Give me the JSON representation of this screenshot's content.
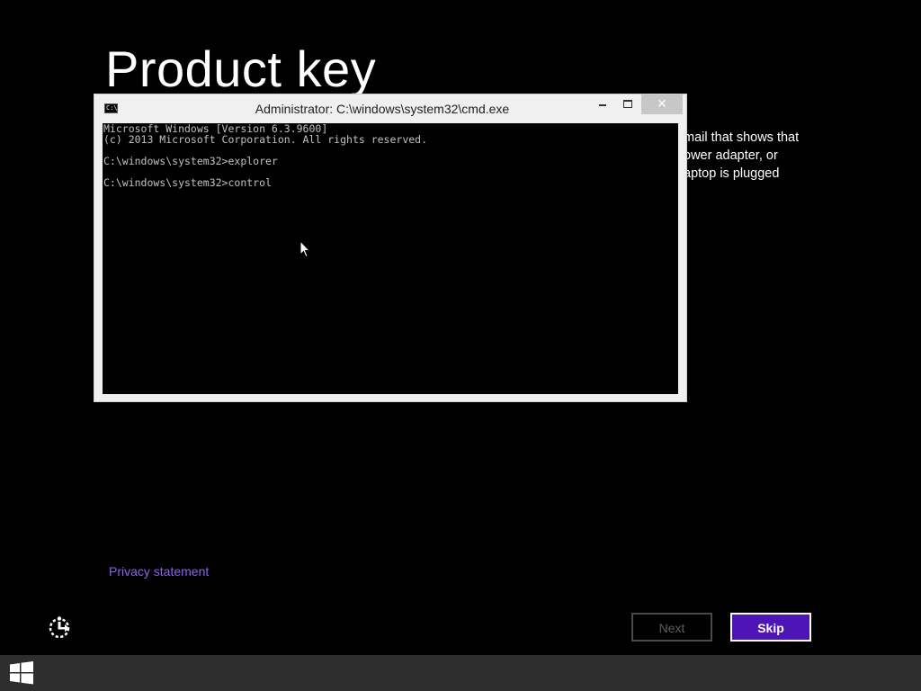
{
  "page": {
    "title": "Product key",
    "description_lines": [
      "mail that shows that",
      "ower adapter, or",
      "aptop is plugged"
    ]
  },
  "cmd": {
    "title": "Administrator: C:\\windows\\system32\\cmd.exe",
    "icon_text": "C:\\",
    "close_glyph": "✕",
    "lines": [
      "Microsoft Windows [Version 6.3.9600]",
      "(c) 2013 Microsoft Corporation. All rights reserved.",
      "C:\\windows\\system32>explorer",
      "C:\\windows\\system32>control"
    ]
  },
  "footer": {
    "privacy_link": "Privacy statement",
    "next_label": "Next",
    "skip_label": "Skip"
  },
  "colors": {
    "background": "#000000",
    "accent": "#4f14b5",
    "link": "#8c63e6",
    "taskbar": "#2e2e2e"
  },
  "icons": {
    "ease_of_access": "ease-of-access-icon",
    "start": "windows-logo-icon",
    "cmd": "cmd-icon"
  }
}
